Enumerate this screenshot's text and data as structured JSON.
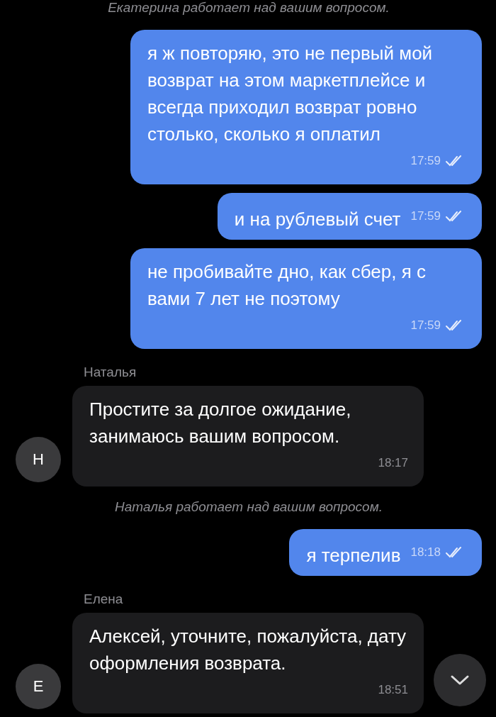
{
  "messages": [
    {
      "kind": "system",
      "text": "Екатерина работает над вашим вопросом."
    },
    {
      "kind": "outgoing",
      "text": "я ж повторяю, это не первый мой возврат на этом маркетплейсе и всегда приходил возврат ровно столько, сколько я оплатил",
      "time": "17:59",
      "read": true
    },
    {
      "kind": "outgoing",
      "text": "и на рублевый счет",
      "time": "17:59",
      "read": true
    },
    {
      "kind": "outgoing",
      "text": "не пробивайте дно, как сбер, я с вами 7 лет не поэтому",
      "time": "17:59",
      "read": true
    },
    {
      "kind": "incoming",
      "sender": "Наталья",
      "avatar": "Н",
      "text": "Простите за долгое ожидание, занимаюсь вашим вопросом.",
      "time": "18:17"
    },
    {
      "kind": "system",
      "text": "Наталья работает над вашим вопросом."
    },
    {
      "kind": "outgoing",
      "text": "я терпелив",
      "time": "18:18",
      "read": true
    },
    {
      "kind": "incoming",
      "sender": "Елена",
      "avatar": "Е",
      "text": "Алексей, уточните, пожалуйста, дату оформления возврата.",
      "time": "18:51"
    }
  ]
}
